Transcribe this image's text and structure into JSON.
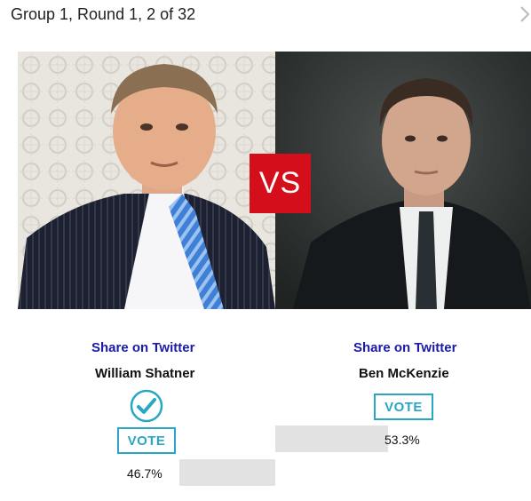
{
  "header": {
    "title": "Group 1, Round 1, 2 of 32",
    "next_icon": "chevron-right-icon"
  },
  "matchup": {
    "vs_label": "VS",
    "vs_color": "#d40f1b"
  },
  "candidates": [
    {
      "name": "William Shatner",
      "share_label": "Share on Twitter",
      "vote_label": "VOTE",
      "percent_label": "46.7%",
      "percent": 46.7,
      "voted": true,
      "voted_icon": "check-circle-icon"
    },
    {
      "name": "Ben McKenzie",
      "share_label": "Share on Twitter",
      "vote_label": "VOTE",
      "percent_label": "53.3%",
      "percent": 53.3,
      "voted": false
    }
  ],
  "colors": {
    "link": "#1a1aa6",
    "vote_accent": "#27a7c4",
    "bar": "#e2e2e2"
  }
}
